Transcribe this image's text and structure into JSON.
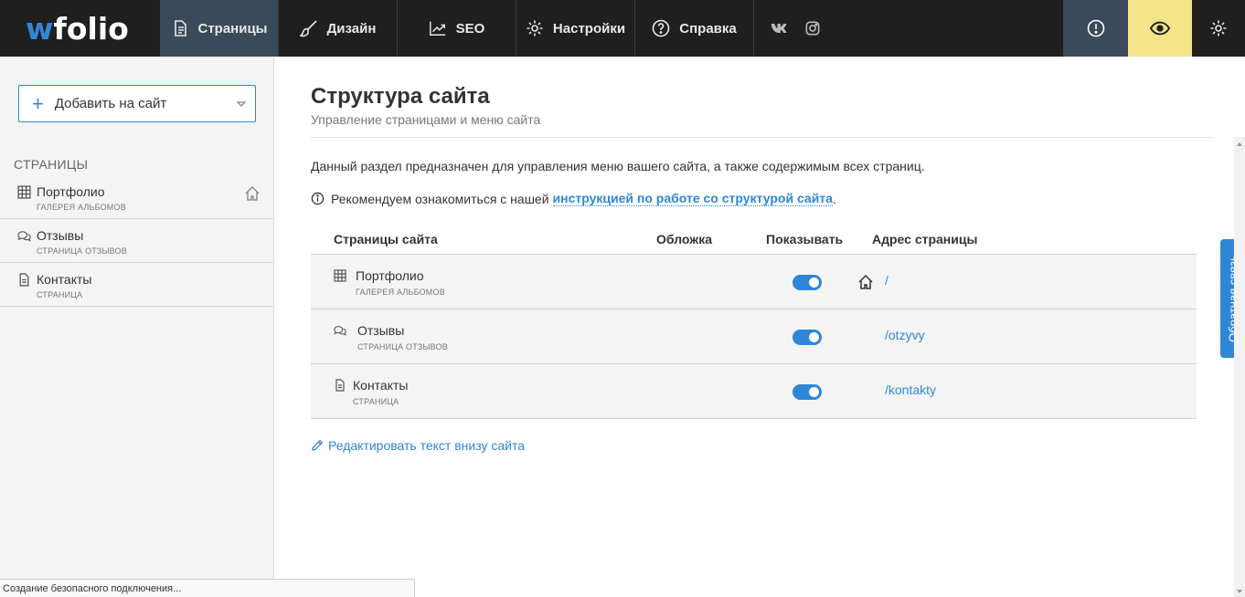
{
  "app": {
    "logo_prefix": "w",
    "logo_rest": "folio"
  },
  "nav": {
    "pages": "Страницы",
    "design": "Дизайн",
    "seo": "SEO",
    "settings": "Настройки",
    "help": "Справка"
  },
  "sidebar": {
    "add_button": "Добавить на сайт",
    "heading": "СТРАНИЦЫ",
    "items": [
      {
        "title": "Портфолио",
        "subtitle": "ГАЛЕРЕЯ АЛЬБОМОВ",
        "icon": "grid-icon",
        "home": true
      },
      {
        "title": "Отзывы",
        "subtitle": "СТРАНИЦА ОТЗЫВОВ",
        "icon": "comments-icon",
        "home": false
      },
      {
        "title": "Контакты",
        "subtitle": "СТРАНИЦА",
        "icon": "document-icon",
        "home": false
      }
    ]
  },
  "main": {
    "title": "Структура сайта",
    "subtitle": "Управление страницами и меню сайта",
    "intro": "Данный раздел предназначен для управления меню вашего сайта, а также содержимым всех страниц.",
    "reco_text": "Рекомендуем ознакомиться с нашей",
    "reco_link": "инструкцией по работе со структурой сайта",
    "reco_end": ".",
    "table": {
      "col_pages": "Страницы сайта",
      "col_cover": "Обложка",
      "col_show": "Показывать",
      "col_address": "Адрес страницы",
      "rows": [
        {
          "title": "Портфолио",
          "subtitle": "ГАЛЕРЕЯ АЛЬБОМОВ",
          "icon": "grid-icon",
          "show": true,
          "home": true,
          "url": "/"
        },
        {
          "title": "Отзывы",
          "subtitle": "СТРАНИЦА ОТЗЫВОВ",
          "icon": "comments-icon",
          "show": true,
          "home": false,
          "url": "/otzyvy"
        },
        {
          "title": "Контакты",
          "subtitle": "СТРАНИЦА",
          "icon": "document-icon",
          "show": true,
          "home": false,
          "url": "/kontakty"
        }
      ]
    },
    "edit_footer_link": "Редактировать текст внизу сайта"
  },
  "feedback_tab": "Обратная связь",
  "status_bar": "Создание безопасного подключения...",
  "colors": {
    "accent": "#2f86d6",
    "topbar": "#1f1f1f",
    "active_nav": "#3a4a5a",
    "preview": "#f3e48a"
  }
}
